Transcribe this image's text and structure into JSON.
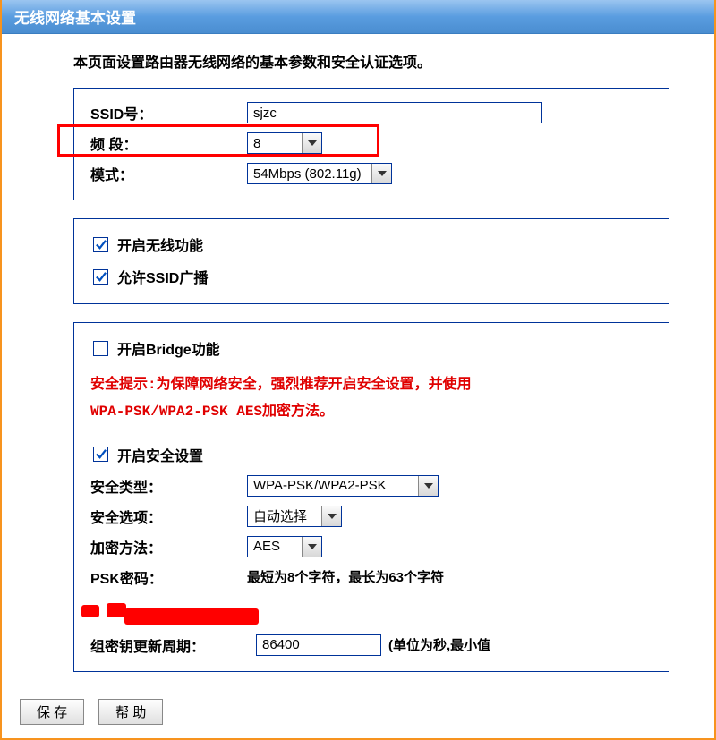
{
  "header": {
    "title": "无线网络基本设置"
  },
  "intro": "本页面设置路由器无线网络的基本参数和安全认证选项。",
  "basic": {
    "ssid_label": "SSID号：",
    "ssid_value": "sjzc",
    "channel_label": "频 段：",
    "channel_value": "8",
    "mode_label": "模式：",
    "mode_value": "54Mbps (802.11g)"
  },
  "toggles": {
    "enable_wireless": {
      "label": "开启无线功能",
      "checked": true
    },
    "allow_ssid_broadcast": {
      "label": "允许SSID广播",
      "checked": true
    }
  },
  "security": {
    "enable_bridge": {
      "label": "开启Bridge功能",
      "checked": false
    },
    "warning_line1": "安全提示:为保障网络安全，强烈推荐开启安全设置，并使用",
    "warning_line2": "WPA-PSK/WPA2-PSK AES加密方法。",
    "enable_security": {
      "label": "开启安全设置",
      "checked": true
    },
    "type_label": "安全类型：",
    "type_value": "WPA-PSK/WPA2-PSK",
    "option_label": "安全选项：",
    "option_value": "自动选择",
    "encrypt_label": "加密方法：",
    "encrypt_value": "AES",
    "psk_label": "PSK密码：",
    "psk_hint": "最短为8个字符，最长为63个字符",
    "group_key_label": "组密钥更新周期：",
    "group_key_value": "86400",
    "group_key_hint": "(单位为秒,最小值"
  },
  "buttons": {
    "save": "保 存",
    "help": "帮 助"
  }
}
